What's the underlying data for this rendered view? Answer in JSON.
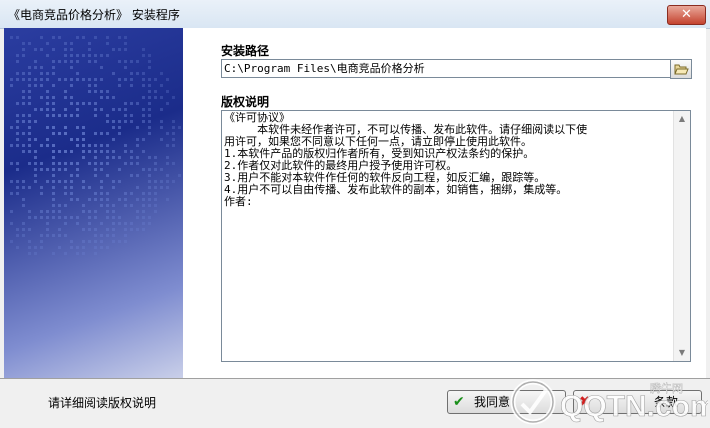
{
  "window": {
    "title": "《电商竞品价格分析》 安装程序",
    "close_glyph": "✕"
  },
  "install_path": {
    "label": "安装路径",
    "value": "C:\\Program Files\\电商竞品价格分析"
  },
  "license": {
    "label": "版权说明",
    "text": "《许可协议》\n     本软件未经作者许可，不可以传播、发布此软件。请仔细阅读以下使\n用许可，如果您不同意以下任何一点，请立即停止使用此软件。\n1.本软件产品的版权归作者所有，受到知识产权法条约的保护。\n2.作者仅对此软件的最终用户授予使用许可权。\n3.用户不能对本软件作任何的软件反向工程，如反汇编，跟踪等。\n4.用户不可以自由传播、发布此软件的副本，如销售，捆绑，集成等。\n作者:"
  },
  "status": {
    "text": "请详细阅读版权说明"
  },
  "buttons": {
    "agree_label": "我同意",
    "disagree_label": "条款"
  },
  "watermark": {
    "site": "QQTN.com",
    "tag": "腾牛网"
  },
  "colors": {
    "panel_blue": "#1b2c8a",
    "close_red": "#c4432f",
    "agree_green": "#1a8f1a",
    "disagree_red": "#d32020"
  }
}
